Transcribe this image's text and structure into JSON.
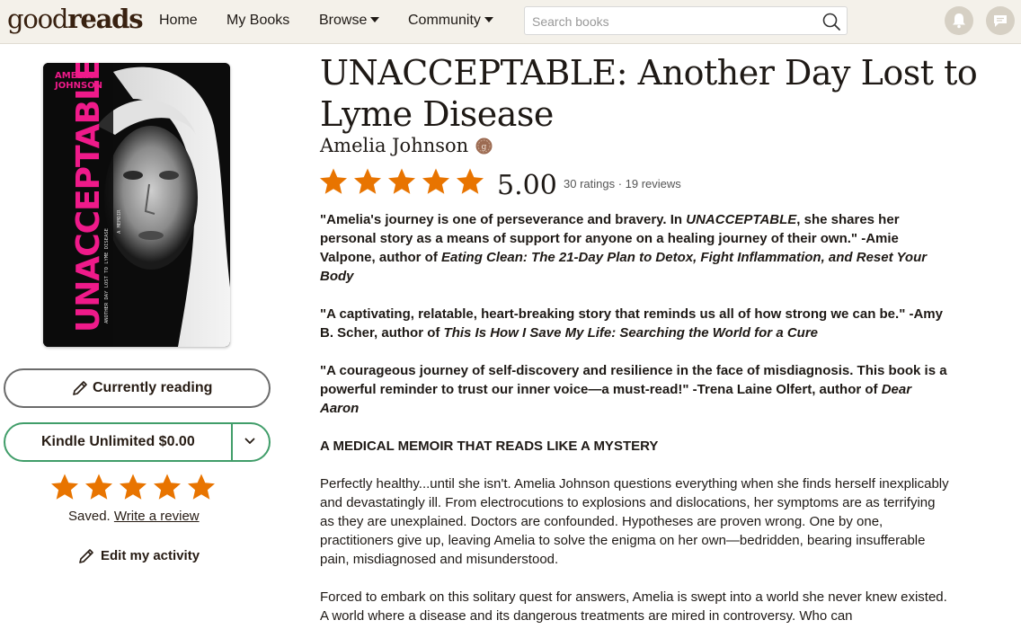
{
  "header": {
    "logo": {
      "light": "good",
      "bold": "reads"
    },
    "nav": [
      {
        "label": "Home"
      },
      {
        "label": "My Books"
      },
      {
        "label": "Browse"
      },
      {
        "label": "Community"
      }
    ],
    "search": {
      "placeholder": "Search books"
    }
  },
  "cover": {
    "author_line1": "AMELIA",
    "author_line2": "JOHNSON",
    "title": "UNACCEPTABLE",
    "subtitle": "ANOTHER DAY LOST TO LYME DISEASE",
    "genre": "A MEMOIR"
  },
  "shelf": {
    "status_label": "Currently reading",
    "kindle_label": "Kindle Unlimited $0.00"
  },
  "user_rating": {
    "stars": 5,
    "saved_text": "Saved.",
    "review_link": "Write a review",
    "edit_activity": "Edit my activity"
  },
  "book": {
    "title": "UNACCEPTABLE: Another Day Lost to Lyme Disease",
    "author": "Amelia Johnson",
    "average_rating": "5.00",
    "rating_stars": 5,
    "counts": "30 ratings · 19 reviews"
  },
  "description": {
    "p1_a": "\"Amelia's journey is one of perseverance and bravery. In ",
    "p1_i1": "UNACCEPTABLE",
    "p1_b": ", she shares her personal story as a means of support for anyone on a healing journey of their own.\" -Amie Valpone, author of ",
    "p1_i2": "Eating Clean: The 21-Day Plan to Detox, Fight Inflammation, and Reset Your Body",
    "p2_a": "\"A captivating, relatable, heart-breaking story that reminds us all of how strong we can be.\" -Amy B. Scher, author of ",
    "p2_i": "This Is How I Save My Life: Searching the World for a Cure",
    "p3_a": "\"A courageous journey of self-discovery and resilience in the face of misdiagnosis. This book is a powerful reminder to trust our inner voice—a must-read!\" -Trena Laine Olfert, author of ",
    "p3_i": "Dear Aaron",
    "heading": "A MEDICAL MEMOIR THAT READS LIKE A MYSTERY",
    "p4": "Perfectly healthy...until she isn't. Amelia Johnson questions everything when she finds herself inexplicably and devastatingly ill. From electrocutions to explosions and dislocations, her symptoms are as terrifying as they are unexplained. Doctors are confounded. Hypotheses are proven wrong. One by one, practitioners give up, leaving Amelia to solve the enigma on her own—bedridden, bearing insufferable pain, misdiagnosed and misunderstood.",
    "p5": "Forced to embark on this solitary quest for answers, Amelia is swept into a world she never knew existed. A world where a disease and its dangerous treatments are mired in controversy. Who can"
  },
  "colors": {
    "header_bg": "#f4f1ea",
    "star_orange": "#e87400",
    "kindle_green": "#409d69",
    "cover_pink": "#ef1a8a"
  }
}
